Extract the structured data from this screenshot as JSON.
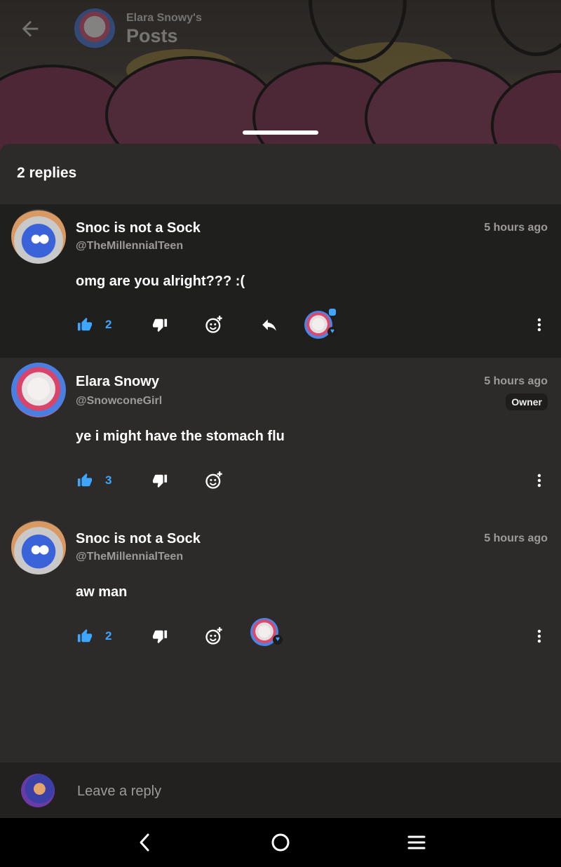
{
  "header": {
    "subtitle": "Elara Snowy's",
    "title": "Posts"
  },
  "sheet": {
    "title": "2 replies"
  },
  "comments": [
    {
      "author": "Snoc is not a Sock",
      "handle": "@TheMillennialTeen",
      "time": "5 hours ago",
      "text": "omg are you alright??? :(",
      "likes": "2",
      "highlighted": true,
      "avatar": "sonic-avatar"
    },
    {
      "author": "Elara Snowy",
      "handle": "@SnowconeGirl",
      "time": "5 hours ago",
      "badge": "Owner",
      "text": "ye i might have the stomach flu",
      "likes": "3",
      "avatar": "elara-avatar"
    },
    {
      "author": "Snoc is not a Sock",
      "handle": "@TheMillennialTeen",
      "time": "5 hours ago",
      "text": "aw man",
      "likes": "2",
      "avatar": "sonic-avatar"
    }
  ],
  "reply": {
    "placeholder": "Leave a reply"
  },
  "colors": {
    "accent": "#3ea6ff",
    "background": "#2d2b29",
    "highlight_row": "#1f1f1e",
    "muted_text": "#9d9a97"
  },
  "icons": [
    "back-arrow-icon",
    "thumbs-up-icon",
    "thumbs-down-icon",
    "add-reaction-icon",
    "reply-arrow-icon",
    "more-vertical-icon",
    "nav-back-icon",
    "nav-home-icon",
    "nav-menu-icon"
  ]
}
